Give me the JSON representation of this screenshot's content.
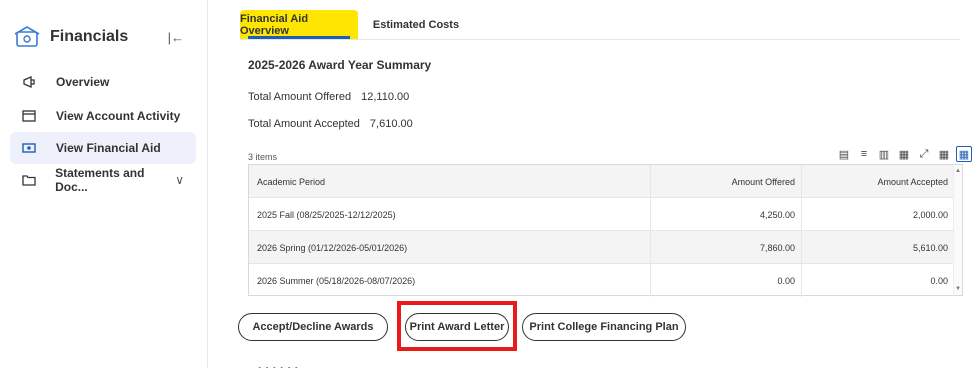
{
  "sidebar": {
    "title": "Financials",
    "items": [
      {
        "label": "Overview",
        "icon": "megaphone-icon"
      },
      {
        "label": "View Account Activity",
        "icon": "card-icon"
      },
      {
        "label": "View Financial Aid",
        "icon": "money-icon"
      },
      {
        "label": "Statements and Doc...",
        "icon": "folder-icon"
      }
    ]
  },
  "tabs": [
    "Financial Aid Overview",
    "Estimated Costs"
  ],
  "summary": {
    "title": "2025-2026 Award Year Summary",
    "offered_label": "Total Amount Offered",
    "offered_value": "12,110.00",
    "accepted_label": "Total Amount Accepted",
    "accepted_value": "7,610.00"
  },
  "table": {
    "count": "3 items",
    "headers": [
      "Academic Period",
      "Amount Offered",
      "Amount Accepted"
    ],
    "rows": [
      [
        "2025 Fall (08/25/2025-12/12/2025)",
        "4,250.00",
        "2,000.00"
      ],
      [
        "2026 Spring (01/12/2026-05/01/2026)",
        "7,860.00",
        "5,610.00"
      ],
      [
        "2026 Summer (05/18/2026-08/07/2026)",
        "0.00",
        "0.00"
      ]
    ]
  },
  "buttons": {
    "accept": "Accept/Decline Awards",
    "print_letter": "Print Award Letter",
    "print_plan": "Print College Financing Plan"
  },
  "colors": {
    "tab_highlight": "#ffe600",
    "accent": "#1d5fb8",
    "annotation": "#e81a1a"
  }
}
